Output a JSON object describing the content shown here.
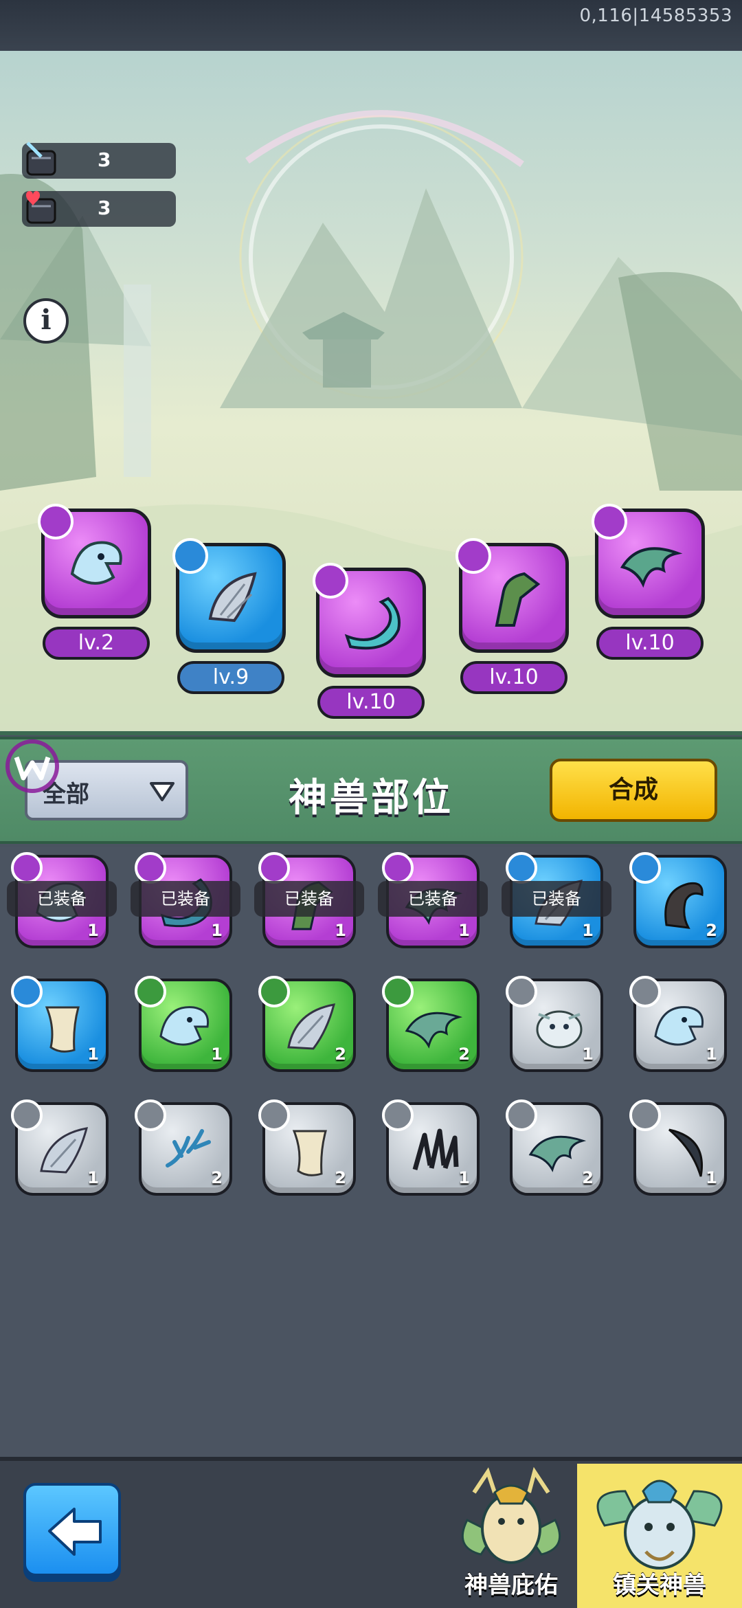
{
  "status": {
    "build_id": "0,116|14585353"
  },
  "counters": [
    {
      "icon": "sword-chest-icon",
      "value": "3"
    },
    {
      "icon": "heart-chest-icon",
      "value": "3"
    }
  ],
  "info_button": {
    "label": "i"
  },
  "equipped_slots": [
    {
      "level": "lv.2",
      "rarity": "purple",
      "type": "sword",
      "item": "bird-head"
    },
    {
      "level": "lv.9",
      "rarity": "blue",
      "type": "sword",
      "item": "wing"
    },
    {
      "level": "lv.10",
      "rarity": "purple",
      "type": "sword",
      "item": "tail"
    },
    {
      "level": "lv.10",
      "rarity": "purple",
      "type": "shield",
      "item": "leg"
    },
    {
      "level": "lv.10",
      "rarity": "purple",
      "type": "shield",
      "item": "fin"
    }
  ],
  "filter": {
    "selected": "全部"
  },
  "section_title": "神兽部位",
  "merge_button": "合成",
  "inventory": [
    {
      "rarity": "purple",
      "type": "sword",
      "count": "1",
      "equipped": "已装备",
      "item": "bird-head"
    },
    {
      "rarity": "purple",
      "type": "sword",
      "count": "1",
      "equipped": "已装备",
      "item": "tail"
    },
    {
      "rarity": "purple",
      "type": "shield",
      "count": "1",
      "equipped": "已装备",
      "item": "leg"
    },
    {
      "rarity": "purple",
      "type": "shield",
      "count": "1",
      "equipped": "已装备",
      "item": "fin"
    },
    {
      "rarity": "blue",
      "type": "sword",
      "count": "1",
      "equipped": "已装备",
      "item": "wing"
    },
    {
      "rarity": "blue",
      "type": "sword",
      "count": "2",
      "equipped": "",
      "item": "horn"
    },
    {
      "rarity": "blue",
      "type": "shield",
      "count": "1",
      "equipped": "",
      "item": "scroll"
    },
    {
      "rarity": "green",
      "type": "sword",
      "count": "1",
      "equipped": "",
      "item": "bird-head"
    },
    {
      "rarity": "green",
      "type": "sword",
      "count": "2",
      "equipped": "",
      "item": "wing"
    },
    {
      "rarity": "green",
      "type": "shield",
      "count": "2",
      "equipped": "",
      "item": "fin"
    },
    {
      "rarity": "gray",
      "type": "sword",
      "count": "1",
      "equipped": "",
      "item": "beast-face"
    },
    {
      "rarity": "gray",
      "type": "sword",
      "count": "1",
      "equipped": "",
      "item": "bird-head"
    },
    {
      "rarity": "gray",
      "type": "sword",
      "count": "1",
      "equipped": "",
      "item": "wing"
    },
    {
      "rarity": "gray",
      "type": "sword",
      "count": "2",
      "equipped": "",
      "item": "antler"
    },
    {
      "rarity": "gray",
      "type": "shield",
      "count": "2",
      "equipped": "",
      "item": "scroll"
    },
    {
      "rarity": "gray",
      "type": "sword",
      "count": "1",
      "equipped": "",
      "item": "claws"
    },
    {
      "rarity": "gray",
      "type": "shield",
      "count": "2",
      "equipped": "",
      "item": "fin"
    },
    {
      "rarity": "gray",
      "type": "sword",
      "count": "1",
      "equipped": "",
      "item": "crescent"
    }
  ],
  "nav": {
    "back": "back-arrow-icon",
    "tab_blessing": "神兽庇佑",
    "tab_guard": "镇关神兽"
  },
  "colors": {
    "purple": "#b43ed3",
    "blue": "#1a8fe0",
    "green": "#3eb53c",
    "gray": "#b5bdc5",
    "merge": "#f2b400",
    "band": "#5d9a72"
  }
}
